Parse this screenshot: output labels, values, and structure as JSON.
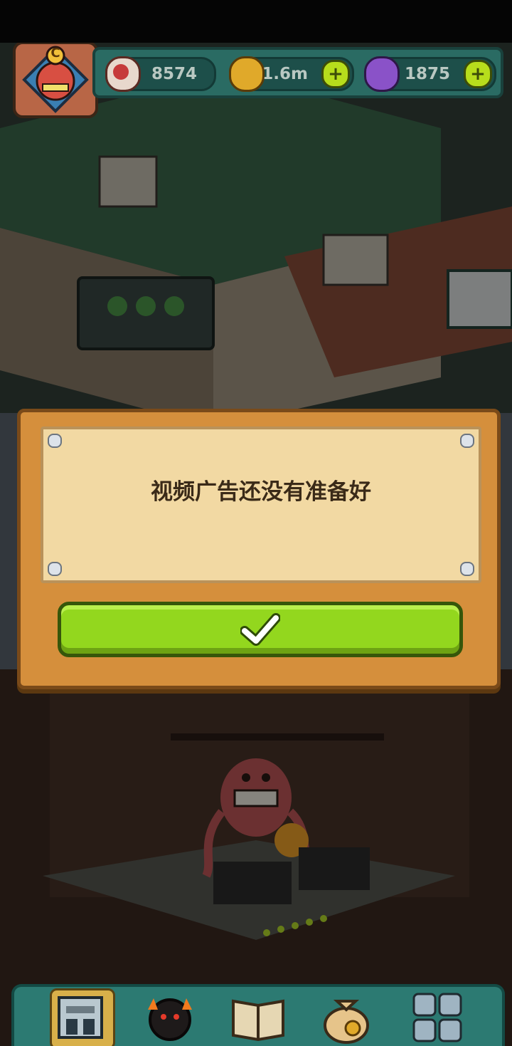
{
  "resources": {
    "eyes": "8574",
    "coins": "1.6m",
    "potions": "1875"
  },
  "avatar_letter": "C",
  "dialog": {
    "message": "视频广告还没有准备好",
    "confirm_icon": "check-icon"
  },
  "nav": {
    "items": [
      {
        "icon": "building-icon"
      },
      {
        "icon": "monster-icon"
      },
      {
        "icon": "book-icon"
      },
      {
        "icon": "money-bag-icon"
      },
      {
        "icon": "grid-menu-icon"
      }
    ]
  },
  "colors": {
    "button_green": "#93d71e",
    "dialog_wood": "#d58f3c",
    "dialog_paper": "#f2d9a3",
    "nav_teal": "#2c7a72"
  }
}
